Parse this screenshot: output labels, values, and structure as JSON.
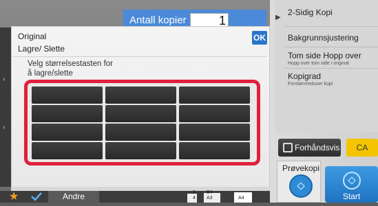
{
  "copies": {
    "label": "Antall kopier",
    "value": "1"
  },
  "dialog": {
    "title": "Original",
    "subtitle": "Lagre/ Slette",
    "ok_label": "OK",
    "instruction_line1": "Velg størrelsestasten for",
    "instruction_line2": "å lagre/slette",
    "size_keys": [
      "",
      "",
      "",
      "",
      "",
      "",
      "",
      "",
      "",
      "",
      "",
      ""
    ]
  },
  "right_panel": {
    "items": [
      {
        "label": "2-Sidig Kopi",
        "sub": ""
      },
      {
        "label": "Bakgrunnsjustering",
        "sub": ""
      },
      {
        "label": "Tom side Hopp over",
        "sub": "Hopp over tom side i original"
      },
      {
        "label": "Kopigrad",
        "sub": "Forstørr/reduser kopi"
      }
    ],
    "preview_label": "Forhåndsvis",
    "ca_label": "CA",
    "proof_label": "Prøvekopi",
    "start_label": "Start"
  },
  "bottom_bar": {
    "other_label": "Andre",
    "paper": {
      "tray3": "3",
      "tray4": "4",
      "size_b4": "B4",
      "size_a3": "A3",
      "size_a4": "A4"
    }
  },
  "colors": {
    "accent_blue": "#2b75c9",
    "highlight_red": "#e0203a",
    "ca_yellow": "#f4c400",
    "star_orange": "#f3a01a"
  }
}
